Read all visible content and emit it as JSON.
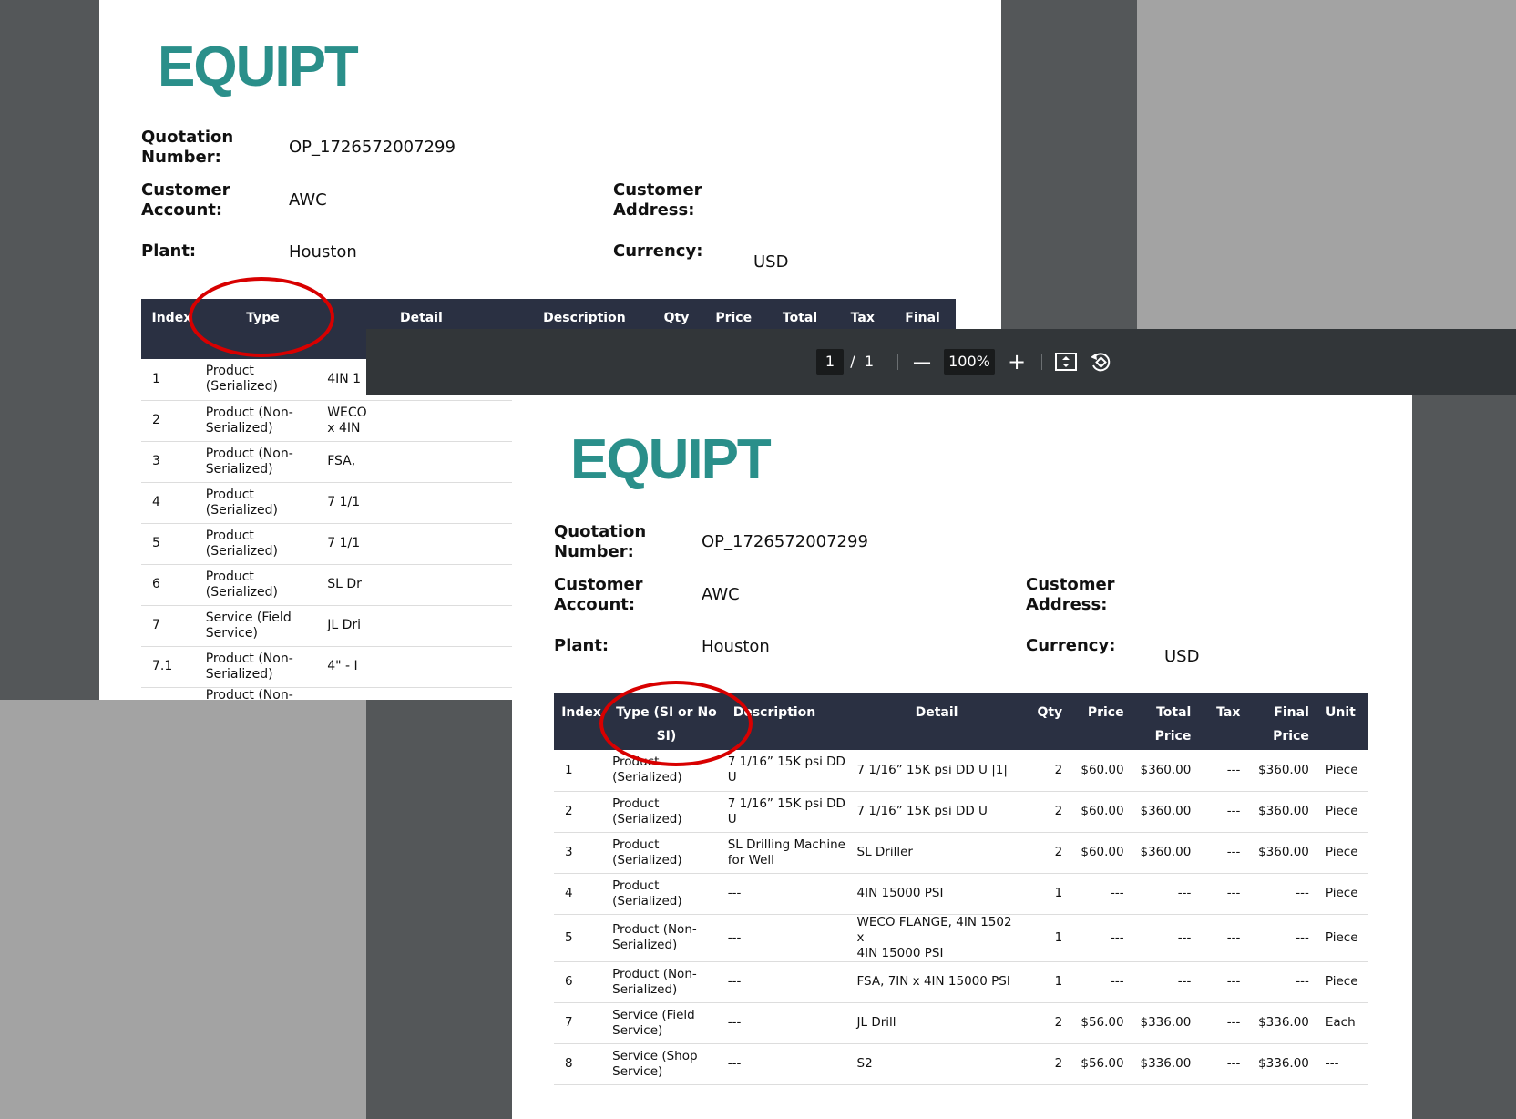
{
  "back_doc": {
    "logo": "EQUIPT",
    "quotation_number_label_1": "Quotation",
    "quotation_number_label_2": "Number:",
    "quotation_number": "OP_1726572007299",
    "customer_account_label_1": "Customer",
    "customer_account_label_2": "Account:",
    "customer_account": "AWC",
    "customer_address_label_1": "Customer",
    "customer_address_label_2": "Address:",
    "plant_label": "Plant:",
    "plant": "Houston",
    "currency_label": "Currency:",
    "currency": "USD",
    "columns": [
      "Index",
      "Type",
      "Detail",
      "Description",
      "Qty",
      "Price",
      "Total",
      "Tax",
      "Final"
    ],
    "rows": [
      {
        "index": "1",
        "type_1": "Product",
        "type_2": "(Serialized)",
        "detail_1": "4IN 1",
        "detail_2": ""
      },
      {
        "index": "2",
        "type_1": "Product (Non-",
        "type_2": "Serialized)",
        "detail_1": "WECO",
        "detail_2": "x 4IN"
      },
      {
        "index": "3",
        "type_1": "Product (Non-",
        "type_2": "Serialized)",
        "detail_1": "FSA,",
        "detail_2": ""
      },
      {
        "index": "4",
        "type_1": "Product",
        "type_2": "(Serialized)",
        "detail_1": "7 1/1",
        "detail_2": ""
      },
      {
        "index": "5",
        "type_1": "Product",
        "type_2": "(Serialized)",
        "detail_1": "7 1/1",
        "detail_2": ""
      },
      {
        "index": "6",
        "type_1": "Product",
        "type_2": "(Serialized)",
        "detail_1": "SL Dr",
        "detail_2": ""
      },
      {
        "index": "7",
        "type_1": "Service (Field",
        "type_2": "Service)",
        "detail_1": "JL Dri",
        "detail_2": ""
      },
      {
        "index": "7.1",
        "type_1": "Product (Non-",
        "type_2": "Serialized)",
        "detail_1": "4\" - I",
        "detail_2": ""
      }
    ],
    "partial_row_type": "Product (Non-"
  },
  "viewer": {
    "page_current": "1",
    "page_sep": "/",
    "page_total": "1",
    "zoom_out_symbol": "—",
    "zoom": "100%",
    "zoom_in_symbol": "+"
  },
  "front_doc": {
    "logo": "EQUIPT",
    "quotation_number_label_1": "Quotation",
    "quotation_number_label_2": "Number:",
    "quotation_number": "OP_1726572007299",
    "customer_account_label_1": "Customer",
    "customer_account_label_2": "Account:",
    "customer_account": "AWC",
    "customer_address_label_1": "Customer",
    "customer_address_label_2": "Address:",
    "plant_label": "Plant:",
    "plant": "Houston",
    "currency_label": "Currency:",
    "currency": "USD",
    "columns": {
      "index": "Index",
      "type_1": "Type (SI or No",
      "type_2": "SI)",
      "description": "Description",
      "detail": "Detail",
      "qty": "Qty",
      "price": "Price",
      "total_1": "Total",
      "total_2": "Price",
      "tax": "Tax",
      "final_1": "Final",
      "final_2": "Price",
      "unit": "Unit"
    },
    "rows": [
      {
        "index": "1",
        "type_1": "Product",
        "type_2": "(Serialized)",
        "desc_1": "7 1/16” 15K psi DD",
        "desc_2": "U",
        "detail_1": "7 1/16” 15K psi DD U |1|",
        "detail_2": "",
        "qty": "2",
        "price": "$60.00",
        "total": "$360.00",
        "tax": "---",
        "final": "$360.00",
        "unit": "Piece"
      },
      {
        "index": "2",
        "type_1": "Product",
        "type_2": "(Serialized)",
        "desc_1": "7 1/16” 15K psi DD",
        "desc_2": "U",
        "detail_1": "7 1/16” 15K psi DD U",
        "detail_2": "",
        "qty": "2",
        "price": "$60.00",
        "total": "$360.00",
        "tax": "---",
        "final": "$360.00",
        "unit": "Piece"
      },
      {
        "index": "3",
        "type_1": "Product",
        "type_2": "(Serialized)",
        "desc_1": "SL Drilling Machine",
        "desc_2": "for Well",
        "detail_1": "SL Driller",
        "detail_2": "",
        "qty": "2",
        "price": "$60.00",
        "total": "$360.00",
        "tax": "---",
        "final": "$360.00",
        "unit": "Piece"
      },
      {
        "index": "4",
        "type_1": "Product",
        "type_2": "(Serialized)",
        "desc_1": "---",
        "desc_2": "",
        "detail_1": "4IN 15000 PSI",
        "detail_2": "",
        "qty": "1",
        "price": "---",
        "total": "---",
        "tax": "---",
        "final": "---",
        "unit": "Piece"
      },
      {
        "index": "5",
        "type_1": "Product (Non-",
        "type_2": "Serialized)",
        "desc_1": "---",
        "desc_2": "",
        "detail_1": "WECO FLANGE, 4IN 1502 x",
        "detail_2": "4IN 15000 PSI",
        "qty": "1",
        "price": "---",
        "total": "---",
        "tax": "---",
        "final": "---",
        "unit": "Piece"
      },
      {
        "index": "6",
        "type_1": "Product (Non-",
        "type_2": "Serialized)",
        "desc_1": "---",
        "desc_2": "",
        "detail_1": "FSA, 7IN x 4IN 15000 PSI",
        "detail_2": "",
        "qty": "1",
        "price": "---",
        "total": "---",
        "tax": "---",
        "final": "---",
        "unit": "Piece"
      },
      {
        "index": "7",
        "type_1": "Service (Field",
        "type_2": "Service)",
        "desc_1": "---",
        "desc_2": "",
        "detail_1": "JL Drill",
        "detail_2": "",
        "qty": "2",
        "price": "$56.00",
        "total": "$336.00",
        "tax": "---",
        "final": "$336.00",
        "unit": "Each"
      },
      {
        "index": "8",
        "type_1": "Service (Shop",
        "type_2": "Service)",
        "desc_1": "---",
        "desc_2": "",
        "detail_1": "S2",
        "detail_2": "",
        "qty": "2",
        "price": "$56.00",
        "total": "$336.00",
        "tax": "---",
        "final": "$336.00",
        "unit": "---"
      }
    ]
  },
  "colors": {
    "brand_teal": "#2a8f8a",
    "table_header": "#2a3042",
    "viewer_toolbar": "#323639",
    "annotation_red": "#d80000"
  }
}
